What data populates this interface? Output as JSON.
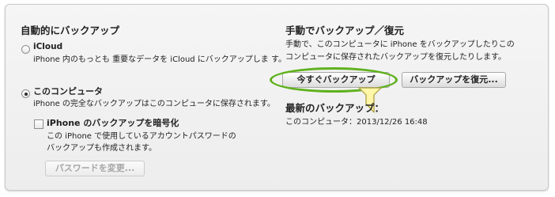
{
  "auto": {
    "title": "自動的にバックアップ",
    "icloud_label": "iCloud",
    "icloud_desc": "iPhone 内のもっとも 重要なデータを iCloud にバックアップしま す。",
    "computer_label": "このコンピュータ",
    "computer_desc": "iPhone の完全なバックアップはこのコンピュータに保存されます。",
    "encrypt_label": "iPhone のバックアップを暗号化",
    "encrypt_desc_1": "この iPhone で使用しているアカウントパスワードの",
    "encrypt_desc_2": "バックアップも作成されます。",
    "change_password_label": "パスワードを変更..."
  },
  "manual": {
    "title": "手動でバックアップ／復元",
    "desc_1": "手動で、このコンピュータに iPhone をバックアップしたりこの",
    "desc_2": "コンピュータに保存されたバックアップを復元したりします。",
    "backup_now_label": "今すぐバックアップ",
    "restore_label": "バックアップを復元..."
  },
  "latest": {
    "title": "最新のバックアップ：",
    "value": "このコンピュータ：2013/12/26 16:48"
  },
  "colors": {
    "highlight_ring": "#5fb11d",
    "pointer_fill": "#fff6a8"
  },
  "icons": {
    "pointer": "callout-arrow-icon"
  }
}
